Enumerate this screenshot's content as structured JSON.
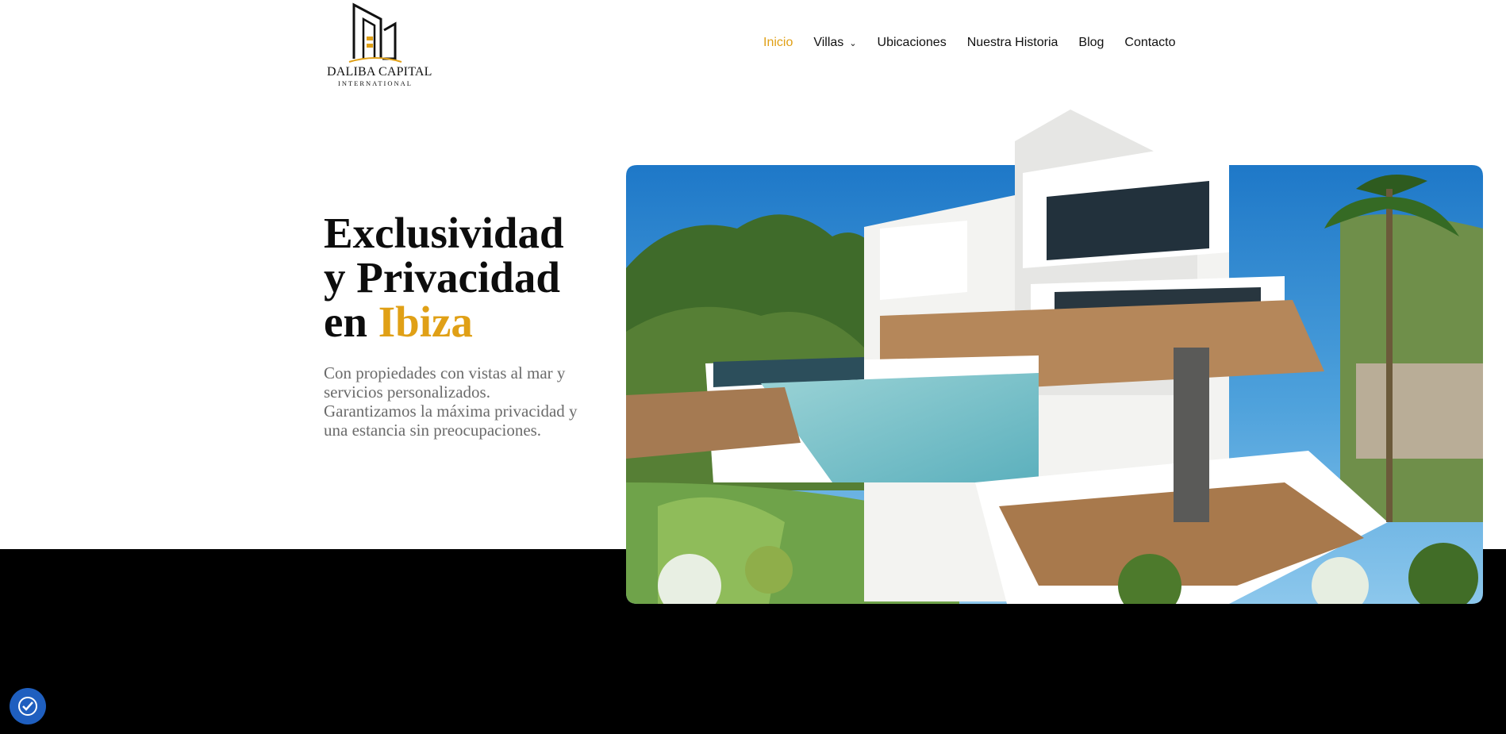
{
  "logo": {
    "name": "DALIBA CAPITAL",
    "subtitle": "INTERNATIONAL"
  },
  "nav": {
    "items": [
      {
        "label": "Inicio"
      },
      {
        "label": "Villas",
        "has_dropdown": true
      },
      {
        "label": "Ubicaciones"
      },
      {
        "label": "Nuestra Historia"
      },
      {
        "label": "Blog"
      },
      {
        "label": "Contacto"
      }
    ],
    "active_index": 0
  },
  "hero": {
    "title_line1": "Exclusividad",
    "title_line2": "y Privacidad",
    "title_line3_prefix": "en ",
    "title_line3_accent": "Ibiza",
    "description": "Con propiedades con vistas al mar y servicios personalizados. Garantizamos la máxima privacidad y una estancia sin preocupaciones."
  },
  "icons": {
    "dropdown": "chevron-down-icon",
    "accessibility": "accessibility-icon"
  },
  "colors": {
    "accent": "#e0a016",
    "text": "#0d0d0d",
    "muted": "#6b6b6b",
    "band": "#000000",
    "accessibility_button": "#1f5fbf"
  }
}
